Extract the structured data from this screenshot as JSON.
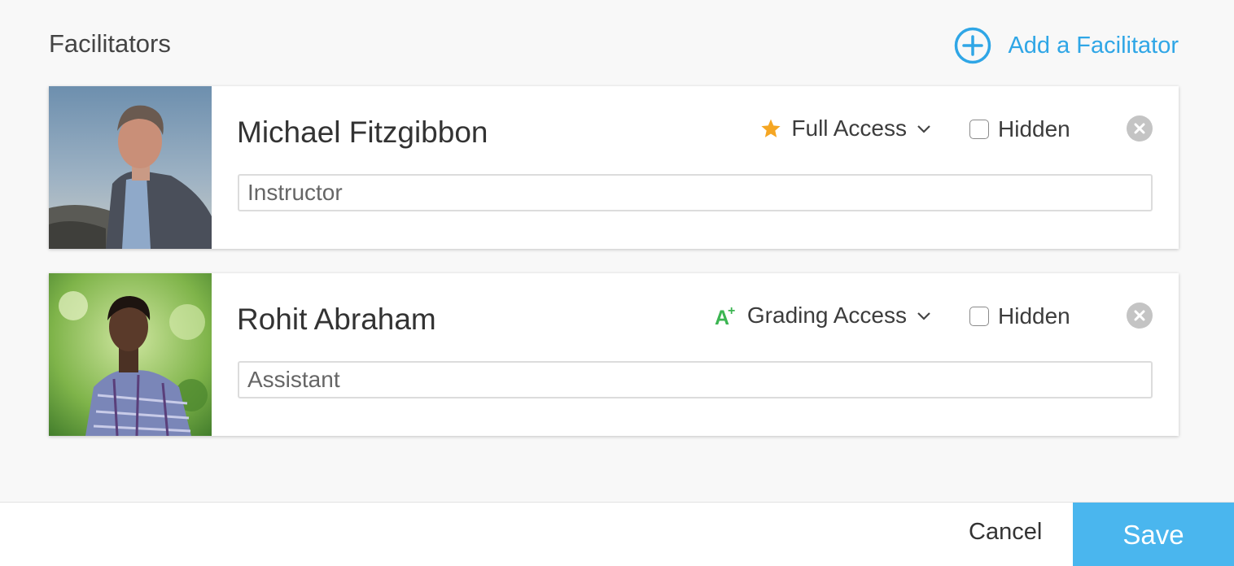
{
  "section": {
    "title": "Facilitators",
    "add_label": "Add a Facilitator",
    "accent_color": "#2fa6e6"
  },
  "facilitators": [
    {
      "name": "Michael Fitzgibbon",
      "access_label": "Full Access",
      "access_icon": "star-icon",
      "access_icon_color": "#f5a623",
      "hidden_label": "Hidden",
      "hidden_checked": false,
      "role": "Instructor"
    },
    {
      "name": "Rohit Abraham",
      "access_label": "Grading Access",
      "access_icon": "a-plus-icon",
      "access_icon_glyph": "A+",
      "access_icon_color": "#3cb552",
      "hidden_label": "Hidden",
      "hidden_checked": false,
      "role": "Assistant"
    }
  ],
  "footer": {
    "cancel_label": "Cancel",
    "save_label": "Save",
    "save_color": "#4ab6ee"
  }
}
